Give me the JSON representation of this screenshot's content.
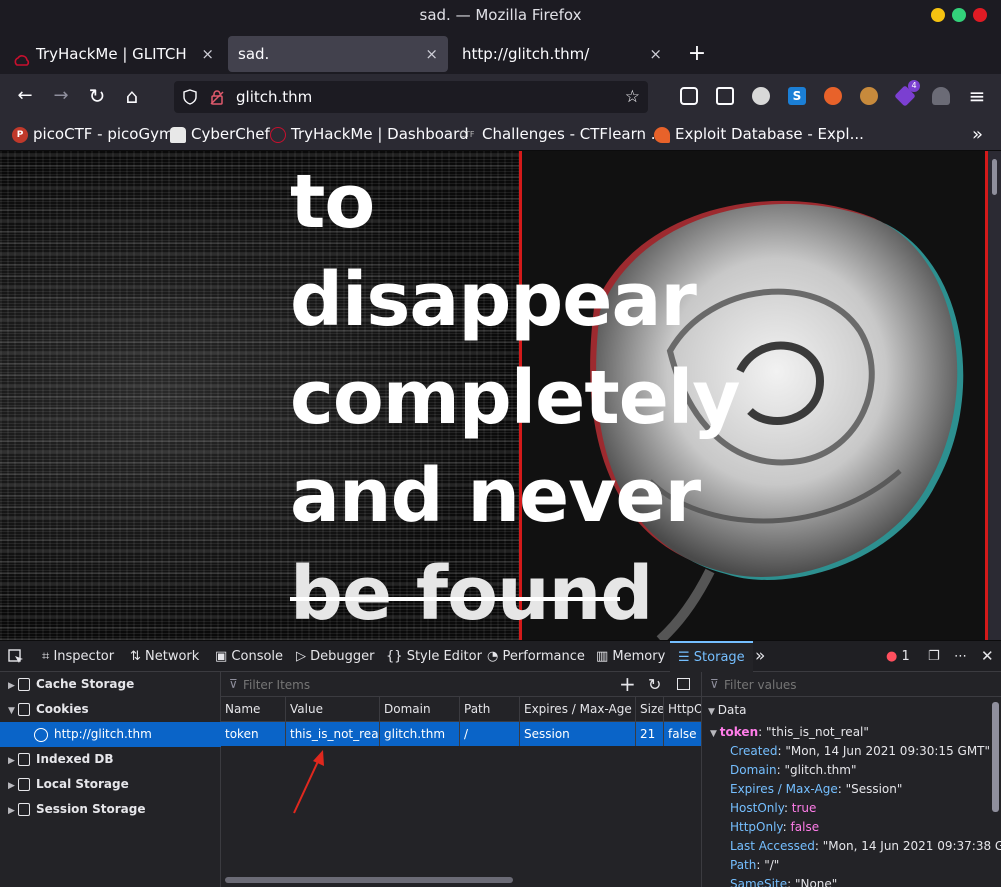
{
  "window": {
    "title": "sad. — Mozilla Firefox",
    "btn_colors": [
      "#f5c211",
      "#33d17a",
      "#e01b24"
    ]
  },
  "tabs": [
    {
      "label": "TryHackMe | GLITCH",
      "close": "×"
    },
    {
      "label": "sad.",
      "close": "×"
    },
    {
      "label": "http://glitch.thm/",
      "close": "×"
    }
  ],
  "newtab": "+",
  "nav": {
    "back": "←",
    "forward": "→",
    "reload": "↻",
    "home": "⌂",
    "url": "glitch.thm",
    "star": "☆",
    "menu": "≡",
    "badge_count": "4"
  },
  "bookmarks": [
    {
      "label": "picoCTF - picoGym",
      "icon": "picoctf-icon",
      "icon_text": "P"
    },
    {
      "label": "CyberChef",
      "icon": "chef-hat-icon",
      "icon_text": ""
    },
    {
      "label": "TryHackMe | Dashboard",
      "icon": "tryhackme-icon",
      "icon_text": ""
    },
    {
      "label": "Challenges - CTFlearn ...",
      "icon": "ctflearn-icon",
      "icon_text": "CTF"
    },
    {
      "label": "Exploit Database - Expl...",
      "icon": "exploitdb-icon",
      "icon_text": ""
    }
  ],
  "bookmarks_overflow": "»",
  "page": {
    "lines": [
      "to",
      "disappear",
      "completely",
      "and never",
      "be found"
    ]
  },
  "devtools": {
    "tabs": [
      "Inspector",
      "Network",
      "Console",
      "Debugger",
      "Style Editor",
      "Performance",
      "Memory",
      "Storage"
    ],
    "active_tab": "Storage",
    "more": "»",
    "error_count": "1",
    "tree": [
      {
        "label": "Cache Storage",
        "arrow": "▶"
      },
      {
        "label": "Cookies",
        "arrow": "▼"
      },
      {
        "label": "http://glitch.thm",
        "arrow": ""
      },
      {
        "label": "Indexed DB",
        "arrow": "▶"
      },
      {
        "label": "Local Storage",
        "arrow": "▶"
      },
      {
        "label": "Session Storage",
        "arrow": "▶"
      }
    ],
    "filter_items": "Filter Items",
    "filter_values": "Filter values",
    "columns": [
      "Name",
      "Value",
      "Domain",
      "Path",
      "Expires / Max-Age",
      "Size",
      "HttpO"
    ],
    "row": [
      "token",
      "this_is_not_real",
      "glitch.thm",
      "/",
      "Session",
      "21",
      "false"
    ],
    "data_header": "Data",
    "data": {
      "token_key": "token",
      "token_val": "\"this_is_not_real\"",
      "items": [
        {
          "k": "Created",
          "v": "\"Mon, 14 Jun 2021 09:30:15 GMT\"",
          "t": "s"
        },
        {
          "k": "Domain",
          "v": "\"glitch.thm\"",
          "t": "s"
        },
        {
          "k": "Expires / Max-Age",
          "v": "\"Session\"",
          "t": "s"
        },
        {
          "k": "HostOnly",
          "v": "true",
          "t": "b"
        },
        {
          "k": "HttpOnly",
          "v": "false",
          "t": "b"
        },
        {
          "k": "Last Accessed",
          "v": "\"Mon, 14 Jun 2021 09:37:38 GMT\"",
          "t": "s"
        },
        {
          "k": "Path",
          "v": "\"/\"",
          "t": "s"
        },
        {
          "k": "SameSite",
          "v": "\"None\"",
          "t": "s"
        }
      ]
    }
  },
  "colors": {
    "accent": "#0a64c8",
    "devtools_active": "#75bfff",
    "glitch_red": "#d41a1a"
  }
}
